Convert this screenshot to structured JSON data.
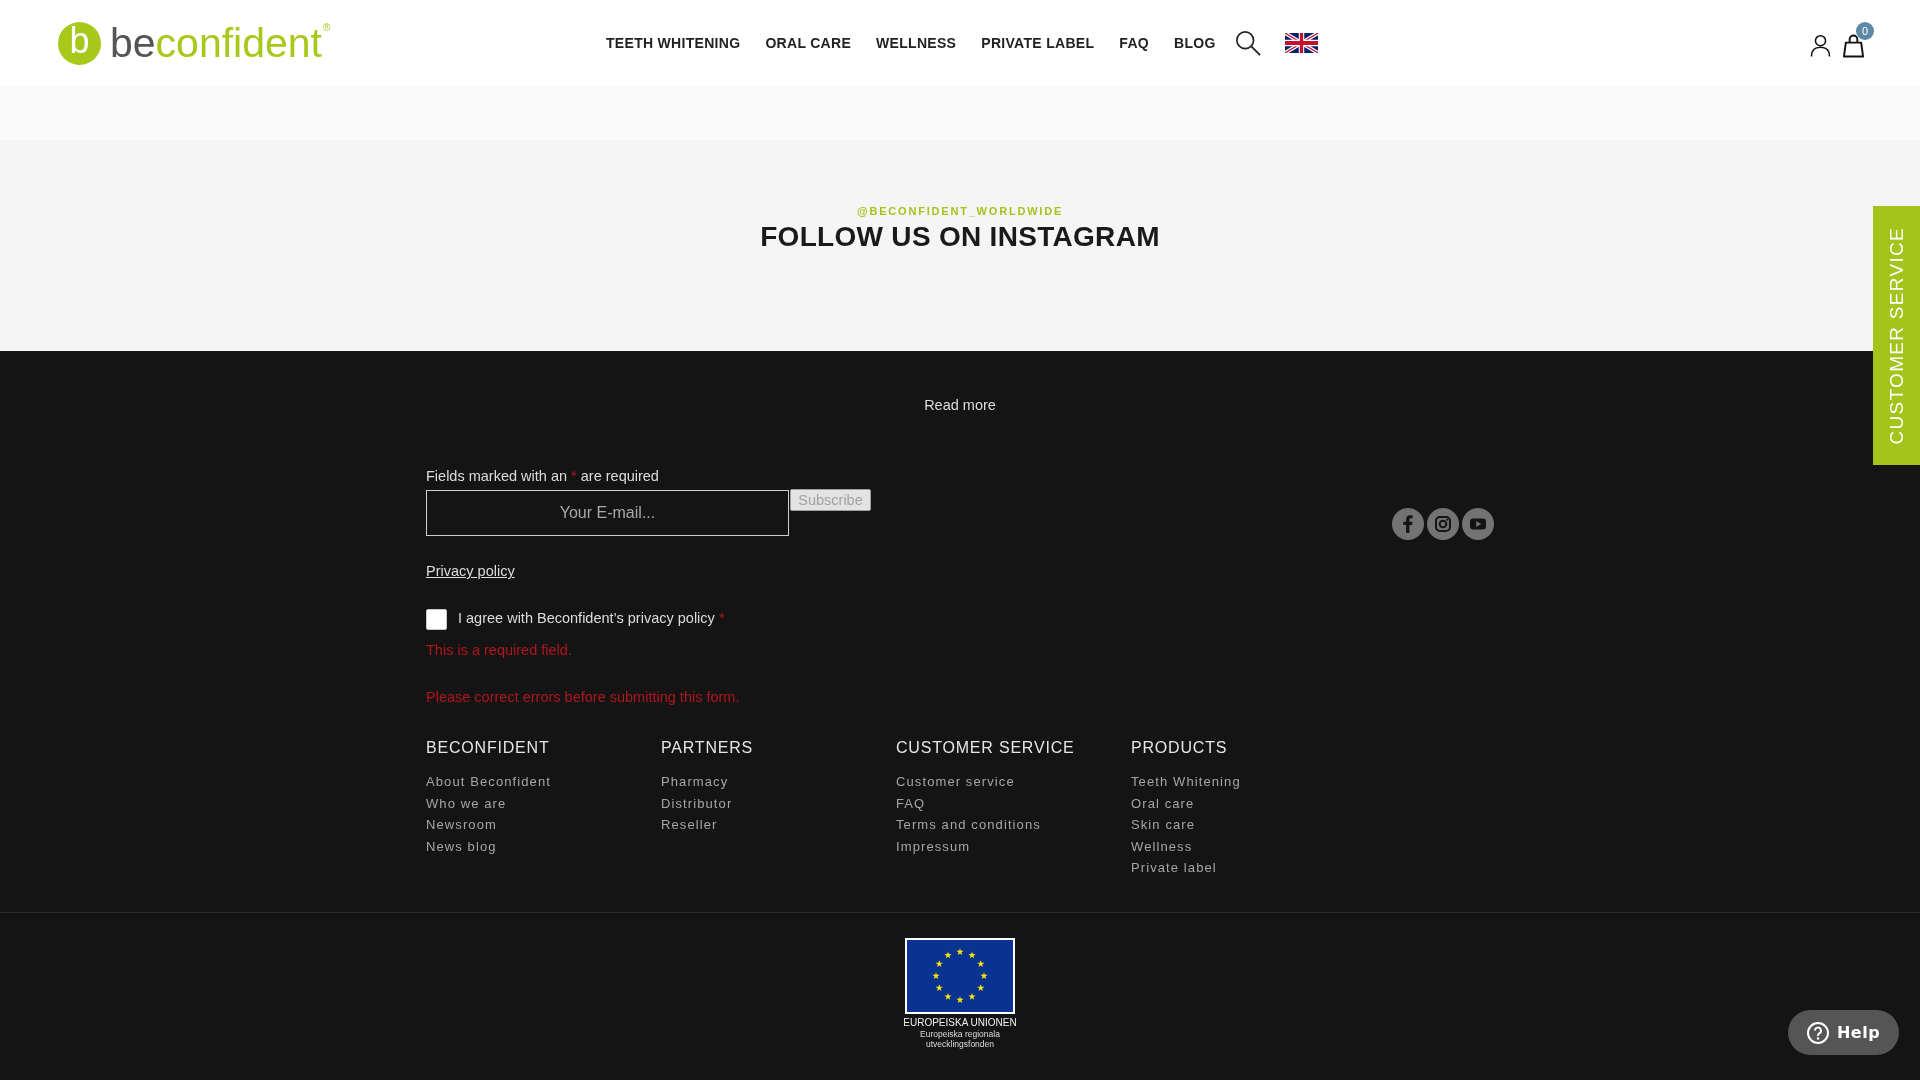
{
  "header": {
    "logo": {
      "letter": "b",
      "dark_part": "be",
      "accent_part": "confident",
      "registered": "®"
    },
    "nav": [
      "TEETH WHITENING",
      "ORAL CARE",
      "WELLNESS",
      "PRIVATE LABEL",
      "FAQ",
      "BLOG"
    ],
    "cart_count": "0"
  },
  "instagram": {
    "handle": "@BECONFIDENT_WORLDWIDE",
    "title": "FOLLOW US ON INSTAGRAM"
  },
  "read_more": "Read more",
  "newsletter": {
    "required_note": {
      "before": "Fields marked with an",
      "mark": "*",
      "after": "are required"
    },
    "email": {
      "placeholder": "Your E-mail..."
    },
    "subscribe": "Subscribe",
    "privacy_link": "Privacy policy",
    "consent": {
      "label": "I agree with Beconfident’s privacy policy",
      "mark": "*",
      "checked": false
    },
    "field_error": "This is a required field.",
    "form_error": "Please correct errors before submitting this form."
  },
  "social": [
    {
      "kind": "facebook"
    },
    {
      "kind": "instagram"
    },
    {
      "kind": "youtube"
    }
  ],
  "footer_columns": [
    {
      "heading": "BECONFIDENT",
      "links": [
        "About Beconfident",
        "Who we are",
        "Newsroom",
        "News blog"
      ]
    },
    {
      "heading": "PARTNERS",
      "links": [
        "Pharmacy",
        "Distributor",
        "Reseller"
      ]
    },
    {
      "heading": "CUSTOMER SERVICE",
      "links": [
        "Customer service",
        "FAQ",
        "Terms and conditions",
        "Impressum"
      ]
    },
    {
      "heading": "PRODUCTS",
      "links": [
        "Teeth Whitening",
        "Oral care",
        "Skin care",
        "Wellness",
        "Private label"
      ]
    }
  ],
  "eu_logo": {
    "title": "EUROPEISKA UNIONEN",
    "subtitle": [
      "Europeiska regionala",
      "utvecklingsfonden"
    ]
  },
  "help_button": {
    "label": "Help"
  },
  "side_tab": {
    "label": "CUSTOMER SERVICE"
  }
}
